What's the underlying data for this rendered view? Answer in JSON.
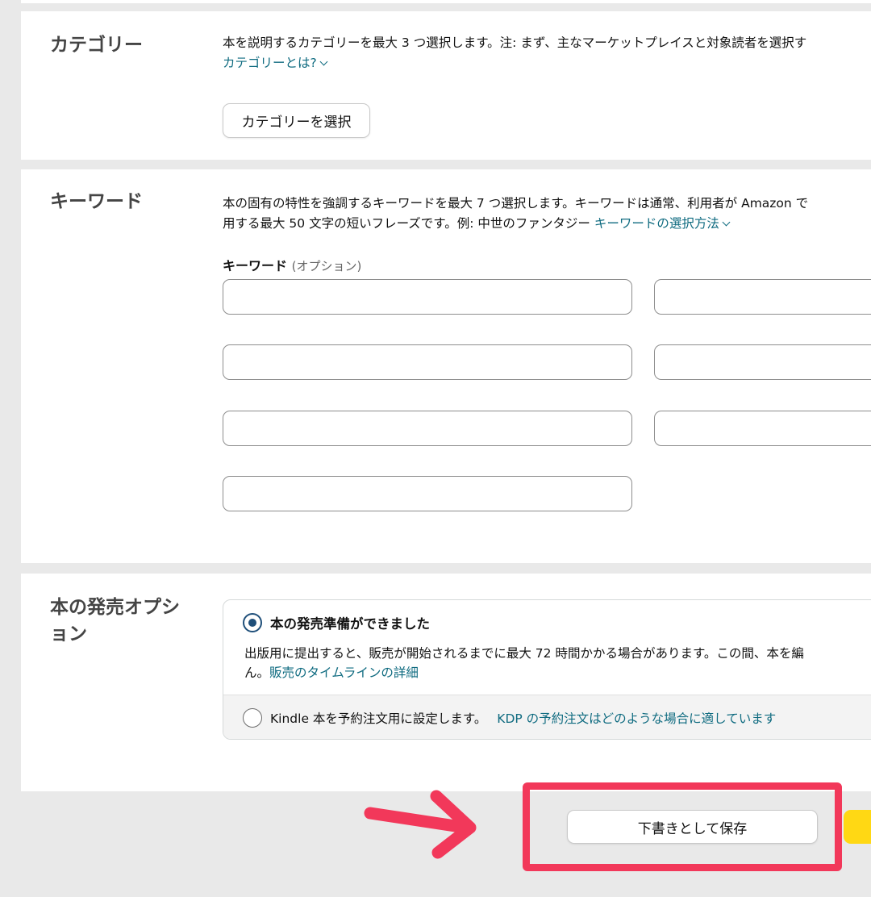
{
  "category": {
    "title": "カテゴリー",
    "description": "本を説明するカテゴリーを最大 3 つ選択します。注: まず、主なマーケットプレイスと対象読者を選択す",
    "help_link": "カテゴリーとは?",
    "select_button": "カテゴリーを選択"
  },
  "keywords": {
    "title": "キーワード",
    "description_line1": "本の固有の特性を強調するキーワードを最大 7 つ選択します。キーワードは通常、利用者が Amazon で",
    "description_line2": "用する最大 50 文字の短いフレーズです。例: 中世のファンタジー",
    "help_link": "キーワードの選択方法",
    "field_label": "キーワード",
    "field_optional": "(オプション)",
    "values": [
      "",
      "",
      "",
      "",
      "",
      "",
      ""
    ]
  },
  "release": {
    "title": "本の発売オプション",
    "option_ready": {
      "label": "本の発売準備ができました",
      "selected": true,
      "description_line1": "出版用に提出すると、販売が開始されるまでに最大 72 時間かかる場合があります。この間、本を編",
      "description_line2": "ん。",
      "link": "販売のタイムラインの詳細"
    },
    "option_preorder": {
      "label": "Kindle 本を予約注文用に設定します。",
      "selected": false,
      "link": "KDP の予約注文はどのような場合に適しています"
    }
  },
  "footer": {
    "save_draft_label": "下書きとして保存"
  },
  "colors": {
    "link": "#0f6b80",
    "annotation": "#f2385a",
    "primary_button": "#ffd814",
    "radio": "#1f4f7a"
  }
}
